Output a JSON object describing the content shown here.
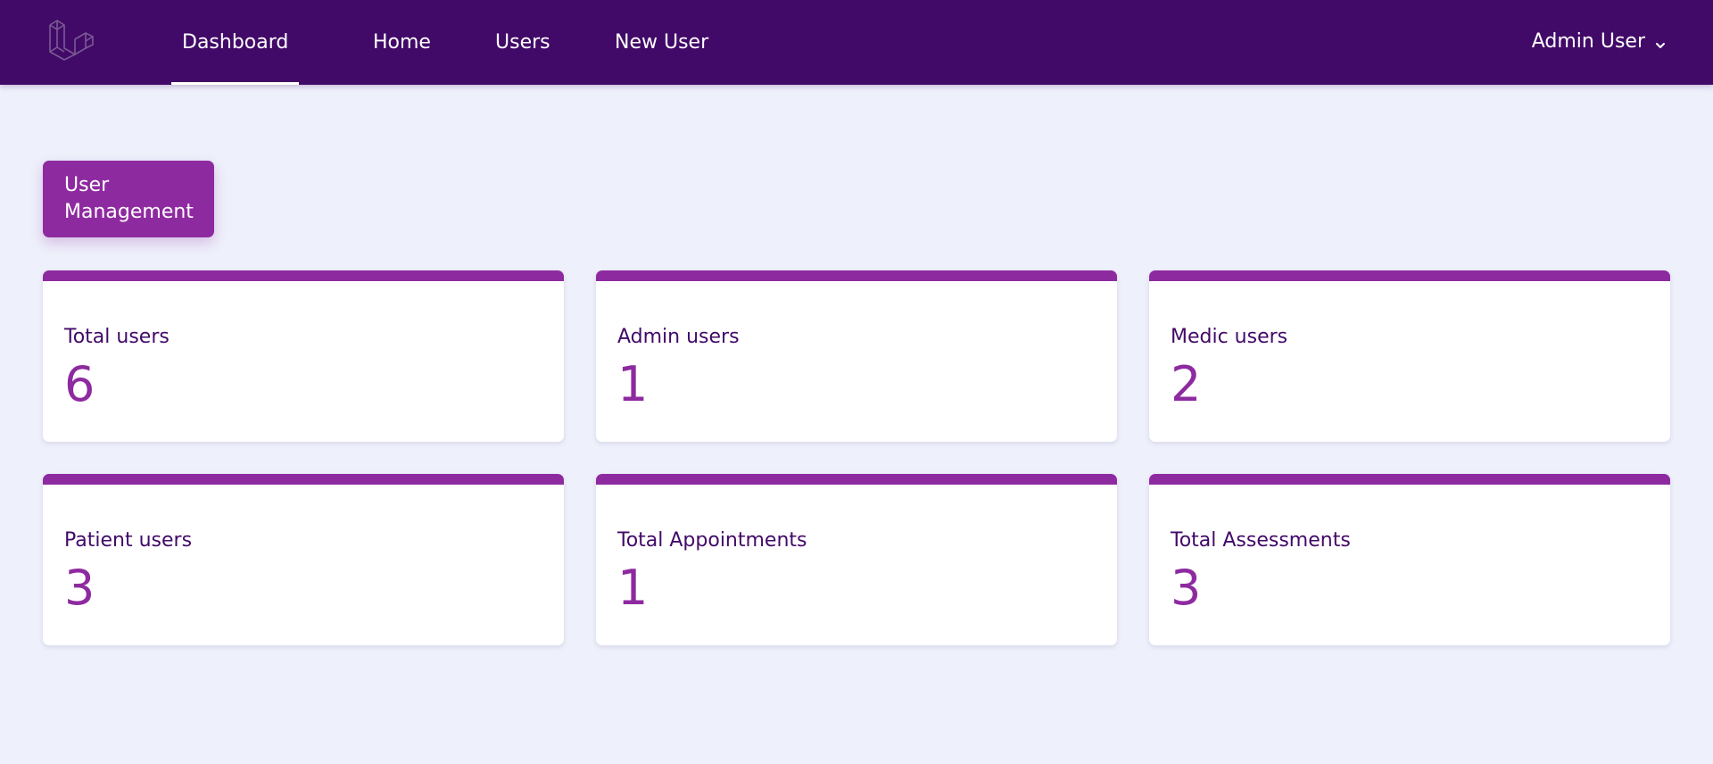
{
  "navbar": {
    "logo_icon": "laravel-logo-icon",
    "links": [
      {
        "label": "Dashboard",
        "active": true
      },
      {
        "label": "Home"
      },
      {
        "label": "Users"
      },
      {
        "label": "New User"
      }
    ],
    "user_menu": {
      "label": "Admin User",
      "icon": "chevron-down-icon"
    }
  },
  "main": {
    "management_button": "User Management",
    "stats": [
      {
        "label": "Total users",
        "value": "6"
      },
      {
        "label": "Admin users",
        "value": "1"
      },
      {
        "label": "Medic users",
        "value": "2"
      },
      {
        "label": "Patient users",
        "value": "3"
      },
      {
        "label": "Total Appointments",
        "value": "1"
      },
      {
        "label": "Total Assessments",
        "value": "3"
      }
    ]
  },
  "colors": {
    "navbar": "#420a68",
    "accent": "#8e2aa0",
    "background": "#eef0fb",
    "label_text": "#420a68"
  }
}
